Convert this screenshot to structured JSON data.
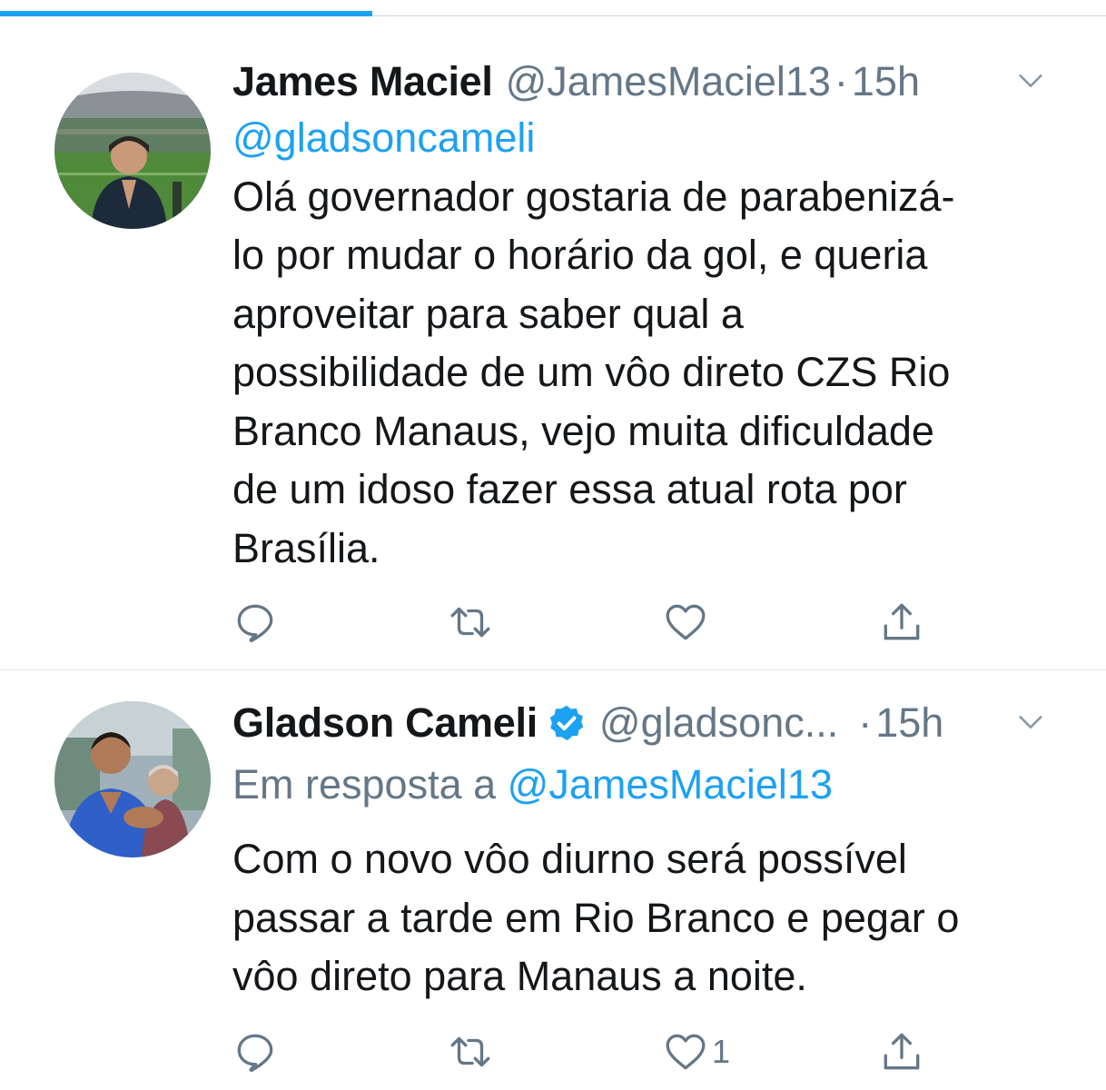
{
  "tweets": [
    {
      "name": "James Maciel",
      "handle": "@JamesMaciel13",
      "separator": "·",
      "time": "15h",
      "mention": "@gladsoncameli",
      "lines": [
        "Olá governador gostaria de parabenizá-",
        "lo por mudar o horário da gol, e queria",
        "aproveitar para saber qual a",
        "possibilidade de um vôo direto CZS Rio",
        "Branco Manaus, vejo muita dificuldade",
        "de um idoso fazer essa atual rota por",
        "Brasília."
      ],
      "actions": {
        "reply_icon": "reply-icon",
        "retweet_icon": "retweet-icon",
        "like_icon": "heart-icon",
        "share_icon": "share-icon"
      }
    },
    {
      "name": "Gladson Cameli",
      "verified": true,
      "handle": "@gladsonc...",
      "separator": "·",
      "time": "15h",
      "reply_prefix": "Em resposta a",
      "reply_to": "@JamesMaciel13",
      "lines": [
        "Com o novo vôo diurno será possível",
        "passar a tarde em Rio Branco e pegar o",
        "vôo direto para Manaus a noite."
      ],
      "like_count": "1",
      "actions": {
        "reply_icon": "reply-icon",
        "retweet_icon": "retweet-icon",
        "like_icon": "heart-icon",
        "share_icon": "share-icon"
      }
    }
  ],
  "colors": {
    "accent": "#1da1f2",
    "muted": "#657786",
    "text": "#14171a",
    "divider": "#e1e8ed"
  }
}
